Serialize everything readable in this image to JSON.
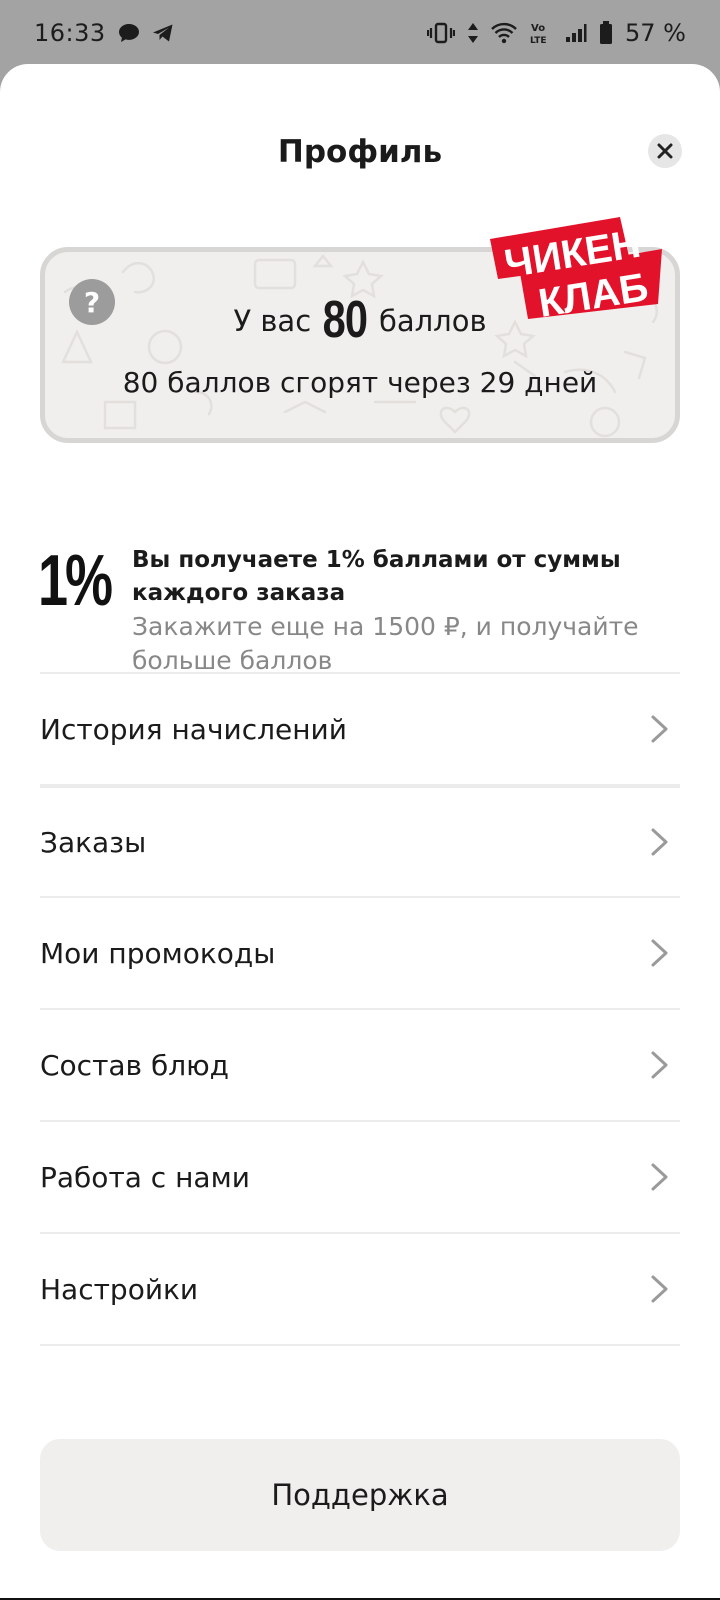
{
  "status_bar": {
    "time": "16:33",
    "battery": "57 %",
    "network_label": "Vo LTE",
    "icons": [
      "chat-bubble-icon",
      "telegram-icon",
      "vibrate-icon",
      "data-arrows-icon",
      "wifi-icon",
      "volte-icon",
      "signal-icon",
      "battery-icon"
    ]
  },
  "header": {
    "title": "Профиль",
    "close_icon": "close-icon"
  },
  "loyalty_card": {
    "help_glyph": "?",
    "points_prefix": "У вас",
    "points_value": "80",
    "points_suffix": "баллов",
    "expire_text": "80 баллов сгорят через 29 дней",
    "logo_line1": "ЧИКЕН",
    "logo_line2": "КЛАБ",
    "logo_color": "#e3122b"
  },
  "cashback": {
    "percent": "1%",
    "title": "Вы получаете 1% баллами от суммы каждого заказа",
    "subtitle": "Закажите еще на 1500 ₽, и получайте больше баллов"
  },
  "menu": {
    "items": [
      {
        "label": "История начислений"
      },
      {
        "label": "Заказы"
      },
      {
        "label": "Мои промокоды"
      },
      {
        "label": "Состав блюд"
      },
      {
        "label": "Работа с нами"
      },
      {
        "label": "Настройки"
      }
    ]
  },
  "support": {
    "label": "Поддержка"
  }
}
